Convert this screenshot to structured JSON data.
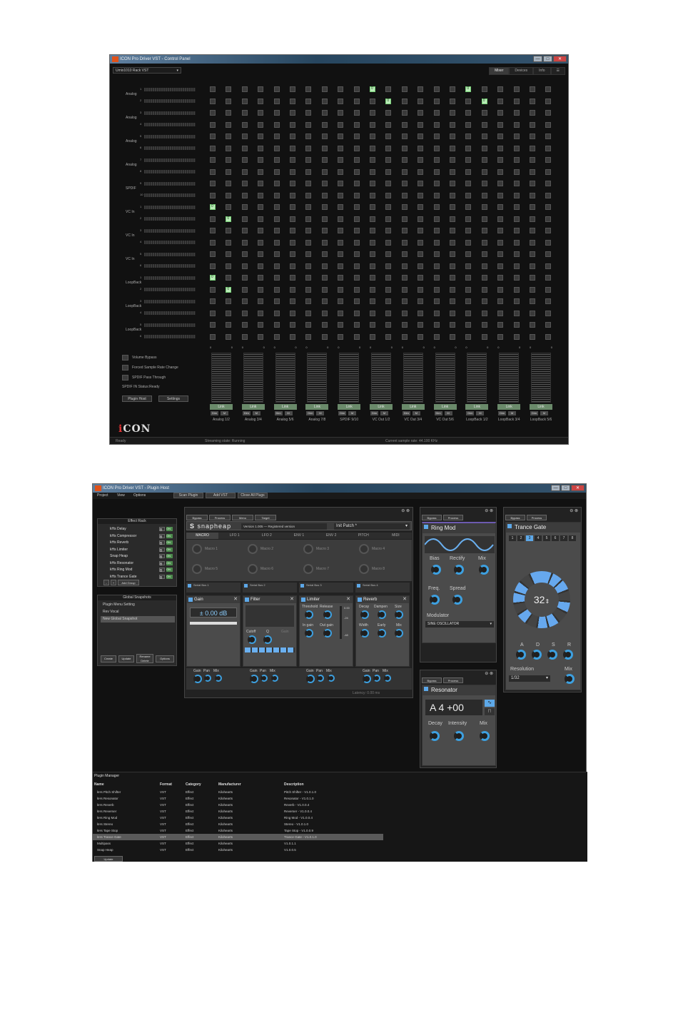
{
  "control_panel": {
    "title": "ICON Pro Driver VST - Control Panel",
    "device": "Umix1010 Rack VST",
    "tabs": [
      "Mixer",
      "Devices",
      "Info",
      "☰"
    ],
    "window_buttons": [
      "—",
      "□",
      "✕"
    ],
    "row_groups": [
      {
        "label": "Analog",
        "channels": [
          "1",
          "2"
        ]
      },
      {
        "label": "Analog",
        "channels": [
          "3",
          "4"
        ]
      },
      {
        "label": "Analog",
        "channels": [
          "5",
          "6"
        ]
      },
      {
        "label": "Analog",
        "channels": [
          "7",
          "8"
        ]
      },
      {
        "label": "SPDIF",
        "channels": [
          "9",
          "10"
        ]
      },
      {
        "label": "VC In",
        "channels": [
          "1",
          "2"
        ]
      },
      {
        "label": "VC In",
        "channels": [
          "3",
          "4"
        ]
      },
      {
        "label": "VC In",
        "channels": [
          "5",
          "6"
        ]
      },
      {
        "label": "LoopBack",
        "channels": [
          "1",
          "2"
        ]
      },
      {
        "label": "LoopBack",
        "channels": [
          "3",
          "4"
        ]
      },
      {
        "label": "LoopBack",
        "channels": [
          "5",
          "6"
        ]
      }
    ],
    "grid": {
      "rows": 22,
      "cols": 22,
      "active": [
        [
          0,
          10
        ],
        [
          1,
          11
        ],
        [
          0,
          16
        ],
        [
          1,
          17
        ],
        [
          10,
          0
        ],
        [
          11,
          1
        ],
        [
          16,
          0
        ],
        [
          17,
          1
        ]
      ],
      "cell_value": "0"
    },
    "options": [
      "Volume Bypass",
      "Forced Sample Rate Change",
      "SPDIF Pass Through"
    ],
    "spdif_status": "SPDIF IN Status:Ready",
    "plugin_host_button": "Plugin Host",
    "settings_button": "Settings",
    "logo": "iCON",
    "strips": [
      "Analog 1/2",
      "Analog 3/4",
      "Analog 5/6",
      "Analog 7/8",
      "SPDIF 9/10",
      "VC Out 1/2",
      "VC Out 3/4",
      "VC Out 5/6",
      "LoopBack 1/2",
      "LoopBack 3/4",
      "LoopBack 5/6"
    ],
    "strip_level": "0",
    "link_label": "Link",
    "dim_label": "Dim",
    "mute_label": "M",
    "status": {
      "left": "Ready",
      "mid": "Streaming state: Running",
      "right": "Current sample rate: 44.100 KHz"
    }
  },
  "plugin_host": {
    "title": "ICON Pro Driver VST - Plugin Host",
    "menu": [
      "Project",
      "View",
      "Options"
    ],
    "toolbar": [
      "Scan Plugin",
      "Add VST",
      "Close All Plugs"
    ],
    "effect_rack": {
      "title": "Effect Rack",
      "items": [
        "kHs Delay",
        "kHs Compressor",
        "kHs Reverb",
        "kHs Limiter",
        "Snap Heap",
        "kHs Resonator",
        "kHs Ring Mod",
        "kHs Trance Gate"
      ],
      "b_label": "B",
      "on_label": "ON",
      "add_group": "Add Group"
    },
    "snapshots": {
      "title": "Global Snapshots",
      "items": [
        "Plugin Menu Setting",
        "Rev Vocal",
        "New Global Snapshot"
      ],
      "buttons": [
        "Create",
        "Update",
        "Rename",
        "Options"
      ],
      "rename_sub": "Delete"
    },
    "snapheap": {
      "tab_buttons": [
        "Bypass",
        "Process",
        "Menu",
        "Target"
      ],
      "logo": "snapheap",
      "version": "Version 1.005 — Registered version",
      "patch": "Init Patch *",
      "mod_tabs": [
        "MACRO",
        "LFO 1",
        "LFO 2",
        "ENV 1",
        "ENV 2",
        "PITCH",
        "MIDI"
      ],
      "macros": [
        "Macro 1",
        "Macro 2",
        "Macro 3",
        "Macro 4",
        "Macro 5",
        "Macro 6",
        "Macro 7",
        "Macro 8"
      ],
      "buses": [
        "Serial Bus 1",
        "Serial Bus 2",
        "Serial Bus 3",
        "Serial Bus 4"
      ],
      "gain": {
        "title": "Gain",
        "value": "± 0.00 dB"
      },
      "filter": {
        "title": "Filter",
        "knobs": [
          "Cutoff",
          "Q",
          "Gain"
        ]
      },
      "limiter": {
        "title": "Limiter",
        "row1": [
          "Threshold",
          "Release"
        ],
        "row2": [
          "In gain",
          "Out gain"
        ],
        "scale": [
          "0.00",
          "0",
          "-24",
          "-48"
        ]
      },
      "reverb": {
        "title": "Reverb",
        "row1": [
          "Decay",
          "Dampen",
          "Size"
        ],
        "row2": [
          "Width",
          "Early",
          "Mix"
        ]
      },
      "foot_knobs": [
        "Gain",
        "Pan",
        "Mix"
      ],
      "latency": "Latency: 0.00 ms"
    },
    "ring_mod": {
      "buttons": [
        "Bypass",
        "Process"
      ],
      "title": "Ring Mod",
      "knobs1": [
        "Bias",
        "Rectify",
        "Mix"
      ],
      "knobs2": [
        "Freq.",
        "Spread"
      ],
      "modulator_label": "Modulator",
      "modulator": "SINE OSCILLATOR"
    },
    "resonator": {
      "buttons": [
        "Bypass",
        "Process"
      ],
      "title": "Resonator",
      "note": "A 4 +00",
      "knobs": [
        "Decay",
        "Intensity",
        "Mix"
      ]
    },
    "trance_gate": {
      "buttons": [
        "Bypass",
        "Process"
      ],
      "title": "Trance Gate",
      "steps": [
        "1",
        "2",
        "3",
        "4",
        "5",
        "6",
        "7",
        "8"
      ],
      "active_step": 3,
      "value": "32",
      "adsr": [
        "A",
        "D",
        "S",
        "R"
      ],
      "resolution_label": "Resolution",
      "resolution": "1/32",
      "mix_label": "Mix"
    },
    "plugin_manager": {
      "title": "Plugin Manager",
      "headers": [
        "Name",
        "Format",
        "Category",
        "Manufacturer",
        "Description"
      ],
      "rows": [
        [
          "kHs Pitch Shifter",
          "VST",
          "Effect",
          "Kilohearts",
          "Pitch Shifter - V1.0.1.0"
        ],
        [
          "kHs Resonator",
          "VST",
          "Effect",
          "Kilohearts",
          "Resonator - V1.0.1.0"
        ],
        [
          "kHs Reverb",
          "VST",
          "Effect",
          "Kilohearts",
          "Reverb - V1.0.0.4"
        ],
        [
          "kHs Reverser",
          "VST",
          "Effect",
          "Kilohearts",
          "Reverser - V1.0.0.4"
        ],
        [
          "kHs Ring Mod",
          "VST",
          "Effect",
          "Kilohearts",
          "Ring Mod - V1.0.0.4"
        ],
        [
          "kHs Stereo",
          "VST",
          "Effect",
          "Kilohearts",
          "Stereo - V1.0.1.0"
        ],
        [
          "kHs Tape Stop",
          "VST",
          "Effect",
          "Kilohearts",
          "Tape Stop - V1.0.0.9"
        ],
        [
          "kHs Trance Gate",
          "VST",
          "Effect",
          "Kilohearts",
          "Trance Gate - V1.0.1.0"
        ],
        [
          "Multipass",
          "VST",
          "Effect",
          "Kilohearts",
          "V1.0.1.1"
        ],
        [
          "Snap Heap",
          "VST",
          "Effect",
          "Kilohearts",
          "V1.0.0.5"
        ]
      ],
      "highlight": 7,
      "update_button": "Update"
    }
  }
}
